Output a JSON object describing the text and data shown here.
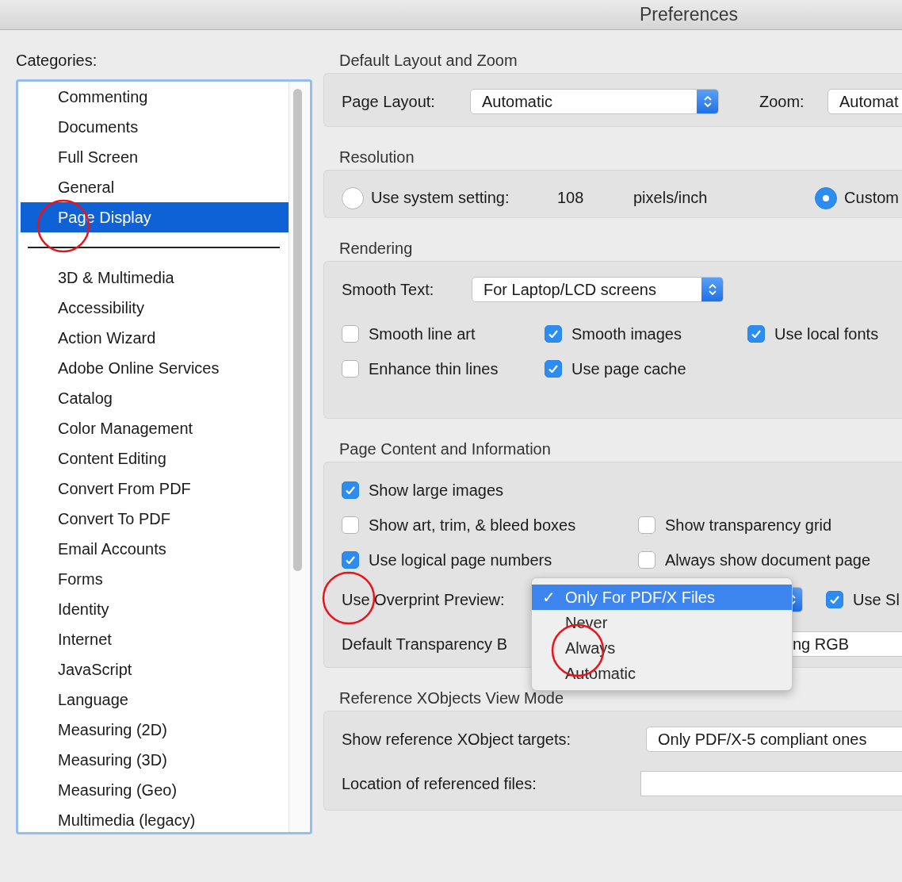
{
  "window": {
    "title": "Preferences"
  },
  "categories": {
    "label": "Categories:",
    "items": [
      {
        "kind": "item",
        "label": "Commenting",
        "selected": false
      },
      {
        "kind": "item",
        "label": "Documents",
        "selected": false
      },
      {
        "kind": "item",
        "label": "Full Screen",
        "selected": false
      },
      {
        "kind": "item",
        "label": "General",
        "selected": false
      },
      {
        "kind": "item",
        "label": "Page Display",
        "selected": true
      },
      {
        "kind": "separator"
      },
      {
        "kind": "item",
        "label": "3D & Multimedia",
        "selected": false
      },
      {
        "kind": "item",
        "label": "Accessibility",
        "selected": false
      },
      {
        "kind": "item",
        "label": "Action Wizard",
        "selected": false
      },
      {
        "kind": "item",
        "label": "Adobe Online Services",
        "selected": false
      },
      {
        "kind": "item",
        "label": "Catalog",
        "selected": false
      },
      {
        "kind": "item",
        "label": "Color Management",
        "selected": false
      },
      {
        "kind": "item",
        "label": "Content Editing",
        "selected": false
      },
      {
        "kind": "item",
        "label": "Convert From PDF",
        "selected": false
      },
      {
        "kind": "item",
        "label": "Convert To PDF",
        "selected": false
      },
      {
        "kind": "item",
        "label": "Email Accounts",
        "selected": false
      },
      {
        "kind": "item",
        "label": "Forms",
        "selected": false
      },
      {
        "kind": "item",
        "label": "Identity",
        "selected": false
      },
      {
        "kind": "item",
        "label": "Internet",
        "selected": false
      },
      {
        "kind": "item",
        "label": "JavaScript",
        "selected": false
      },
      {
        "kind": "item",
        "label": "Language",
        "selected": false
      },
      {
        "kind": "item",
        "label": "Measuring (2D)",
        "selected": false
      },
      {
        "kind": "item",
        "label": "Measuring (3D)",
        "selected": false
      },
      {
        "kind": "item",
        "label": "Measuring (Geo)",
        "selected": false
      },
      {
        "kind": "item",
        "label": "Multimedia (legacy)",
        "selected": false
      }
    ]
  },
  "layout_zoom": {
    "title": "Default Layout and Zoom",
    "page_layout": {
      "label": "Page Layout:",
      "value": "Automatic"
    },
    "zoom": {
      "label": "Zoom:",
      "value": "Automat"
    }
  },
  "resolution": {
    "title": "Resolution",
    "options": [
      {
        "label": "Use system setting:",
        "selected": false,
        "value": "108",
        "unit": "pixels/inch"
      },
      {
        "label": "Custom",
        "selected": true
      }
    ]
  },
  "rendering": {
    "title": "Rendering",
    "smooth_text": {
      "label": "Smooth Text:",
      "value": "For Laptop/LCD screens"
    },
    "checkbox_rows": [
      {
        "items": [
          {
            "label": "Smooth line art",
            "checked": false
          },
          {
            "label": "Smooth images",
            "checked": true
          },
          {
            "label": "Use local fonts",
            "checked": true
          }
        ]
      },
      {
        "items": [
          {
            "label": "Enhance thin lines",
            "checked": false
          },
          {
            "label": "Use page cache",
            "checked": true
          }
        ]
      }
    ]
  },
  "page_content": {
    "title": "Page Content and Information",
    "checkbox_rows": [
      {
        "items": [
          {
            "label": "Show large images",
            "checked": true
          }
        ]
      },
      {
        "items": [
          {
            "label": "Show art, trim, & bleed boxes",
            "checked": false
          },
          {
            "label": "Show transparency grid",
            "checked": false
          }
        ]
      },
      {
        "items": [
          {
            "label": "Use logical page numbers",
            "checked": true
          },
          {
            "label": "Always show document page",
            "checked": false
          }
        ]
      }
    ],
    "overprint": {
      "label": "Use Overprint Preview:",
      "menu": {
        "check": "✓",
        "options": [
          {
            "label": "Only For PDF/X Files",
            "selected": true
          },
          {
            "label": "Never",
            "selected": false
          },
          {
            "label": "Always",
            "selected": false
          },
          {
            "label": "Automatic",
            "selected": false
          }
        ]
      },
      "side_checkbox": {
        "label": "Use Sl",
        "checked": true
      }
    },
    "transparency": {
      "label": "Default Transparency B",
      "value": "ng RGB"
    }
  },
  "xobjects": {
    "title": "Reference XObjects View Mode",
    "targets": {
      "label": "Show reference XObject targets:",
      "value": "Only PDF/X-5 compliant ones"
    },
    "location": {
      "label": "Location of referenced files:"
    }
  }
}
